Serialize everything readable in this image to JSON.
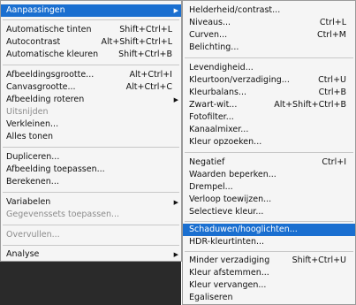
{
  "main_menu": {
    "items": [
      {
        "label": "Aanpassingen",
        "shortcut": "",
        "submenu": true,
        "disabled": false,
        "highlighted": true
      },
      {
        "label": "Automatische tinten",
        "shortcut": "Shift+Ctrl+L",
        "submenu": false,
        "disabled": false,
        "highlighted": false
      },
      {
        "label": "Autocontrast",
        "shortcut": "Alt+Shift+Ctrl+L",
        "submenu": false,
        "disabled": false,
        "highlighted": false
      },
      {
        "label": "Automatische kleuren",
        "shortcut": "Shift+Ctrl+B",
        "submenu": false,
        "disabled": false,
        "highlighted": false
      },
      {
        "label": "Afbeeldingsgrootte...",
        "shortcut": "Alt+Ctrl+I",
        "submenu": false,
        "disabled": false,
        "highlighted": false
      },
      {
        "label": "Canvasgrootte...",
        "shortcut": "Alt+Ctrl+C",
        "submenu": false,
        "disabled": false,
        "highlighted": false
      },
      {
        "label": "Afbeelding roteren",
        "shortcut": "",
        "submenu": true,
        "disabled": false,
        "highlighted": false
      },
      {
        "label": "Uitsnijden",
        "shortcut": "",
        "submenu": false,
        "disabled": true,
        "highlighted": false
      },
      {
        "label": "Verkleinen...",
        "shortcut": "",
        "submenu": false,
        "disabled": false,
        "highlighted": false
      },
      {
        "label": "Alles tonen",
        "shortcut": "",
        "submenu": false,
        "disabled": false,
        "highlighted": false
      },
      {
        "label": "Dupliceren...",
        "shortcut": "",
        "submenu": false,
        "disabled": false,
        "highlighted": false
      },
      {
        "label": "Afbeelding toepassen...",
        "shortcut": "",
        "submenu": false,
        "disabled": false,
        "highlighted": false
      },
      {
        "label": "Berekenen...",
        "shortcut": "",
        "submenu": false,
        "disabled": false,
        "highlighted": false
      },
      {
        "label": "Variabelen",
        "shortcut": "",
        "submenu": true,
        "disabled": false,
        "highlighted": false
      },
      {
        "label": "Gegevenssets toepassen...",
        "shortcut": "",
        "submenu": false,
        "disabled": true,
        "highlighted": false
      },
      {
        "label": "Overvullen...",
        "shortcut": "",
        "submenu": false,
        "disabled": true,
        "highlighted": false
      },
      {
        "label": "Analyse",
        "shortcut": "",
        "submenu": true,
        "disabled": false,
        "highlighted": false
      }
    ]
  },
  "sub_menu": {
    "items": [
      {
        "label": "Helderheid/contrast...",
        "shortcut": "",
        "disabled": false,
        "highlighted": false
      },
      {
        "label": "Niveaus...",
        "shortcut": "Ctrl+L",
        "disabled": false,
        "highlighted": false
      },
      {
        "label": "Curven...",
        "shortcut": "Ctrl+M",
        "disabled": false,
        "highlighted": false
      },
      {
        "label": "Belichting...",
        "shortcut": "",
        "disabled": false,
        "highlighted": false
      },
      {
        "label": "Levendigheid...",
        "shortcut": "",
        "disabled": false,
        "highlighted": false
      },
      {
        "label": "Kleurtoon/verzadiging...",
        "shortcut": "Ctrl+U",
        "disabled": false,
        "highlighted": false
      },
      {
        "label": "Kleurbalans...",
        "shortcut": "Ctrl+B",
        "disabled": false,
        "highlighted": false
      },
      {
        "label": "Zwart-wit...",
        "shortcut": "Alt+Shift+Ctrl+B",
        "disabled": false,
        "highlighted": false
      },
      {
        "label": "Fotofilter...",
        "shortcut": "",
        "disabled": false,
        "highlighted": false
      },
      {
        "label": "Kanaalmixer...",
        "shortcut": "",
        "disabled": false,
        "highlighted": false
      },
      {
        "label": "Kleur opzoeken...",
        "shortcut": "",
        "disabled": false,
        "highlighted": false
      },
      {
        "label": "Negatief",
        "shortcut": "Ctrl+I",
        "disabled": false,
        "highlighted": false
      },
      {
        "label": "Waarden beperken...",
        "shortcut": "",
        "disabled": false,
        "highlighted": false
      },
      {
        "label": "Drempel...",
        "shortcut": "",
        "disabled": false,
        "highlighted": false
      },
      {
        "label": "Verloop toewijzen...",
        "shortcut": "",
        "disabled": false,
        "highlighted": false
      },
      {
        "label": "Selectieve kleur...",
        "shortcut": "",
        "disabled": false,
        "highlighted": false
      },
      {
        "label": "Schaduwen/hooglichten...",
        "shortcut": "",
        "disabled": false,
        "highlighted": true
      },
      {
        "label": "HDR-kleurtinten...",
        "shortcut": "",
        "disabled": false,
        "highlighted": false
      },
      {
        "label": "Minder verzadiging",
        "shortcut": "Shift+Ctrl+U",
        "disabled": false,
        "highlighted": false
      },
      {
        "label": "Kleur afstemmen...",
        "shortcut": "",
        "disabled": false,
        "highlighted": false
      },
      {
        "label": "Kleur vervangen...",
        "shortcut": "",
        "disabled": false,
        "highlighted": false
      },
      {
        "label": "Egaliseren",
        "shortcut": "",
        "disabled": false,
        "highlighted": false
      }
    ]
  },
  "colors": {
    "highlight": "#1a6fd0",
    "menu_bg": "#f5f5f5",
    "disabled_text": "#8c8c8c"
  }
}
